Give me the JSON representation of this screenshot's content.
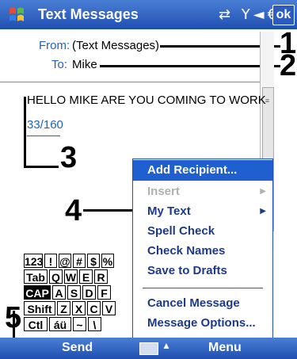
{
  "titlebar": {
    "title": "Text Messages",
    "status_icons": "⇄ Y◄€",
    "ok_label": "ok"
  },
  "header": {
    "from_label": "From:",
    "from_value": "(Text Messages)",
    "to_label": "To:",
    "to_value": "Mike"
  },
  "message": {
    "body": "HELLO MIKE ARE YOU COMING TO WORK",
    "counter": "33/160"
  },
  "callouts": [
    "1",
    "2",
    "3",
    "4",
    "5"
  ],
  "menu": {
    "items": [
      {
        "label": "Add Recipient...",
        "state": "highlighted"
      },
      {
        "label": "Insert",
        "state": "disabled",
        "submenu": true
      },
      {
        "label": "My Text",
        "state": "normal",
        "submenu": true
      },
      {
        "label": "Spell Check",
        "state": "normal"
      },
      {
        "label": "Check Names",
        "state": "normal"
      },
      {
        "label": "Save to Drafts",
        "state": "normal"
      },
      {
        "label": "Cancel Message",
        "state": "normal"
      },
      {
        "label": "Message Options...",
        "state": "normal"
      }
    ],
    "submenu_glyph": "▶"
  },
  "keyboard": {
    "rows": [
      [
        "123",
        "!",
        "@",
        "#",
        "$",
        "%"
      ],
      [
        "Tab",
        "Q",
        "W",
        "E",
        "R"
      ],
      [
        "CAP",
        "A",
        "S",
        "D",
        "F"
      ],
      [
        "Shift",
        "Z",
        "X",
        "C",
        "V"
      ],
      [
        "Ctl",
        "áü",
        "~",
        "\\"
      ]
    ]
  },
  "bottombar": {
    "left_soft_key": "Send",
    "right_soft_key": "Menu",
    "input_arrow": "▲"
  },
  "colors": {
    "bar_blue": "#1f4fb0",
    "highlight": "#1f5fd0",
    "label_blue": "#1e63b8"
  }
}
